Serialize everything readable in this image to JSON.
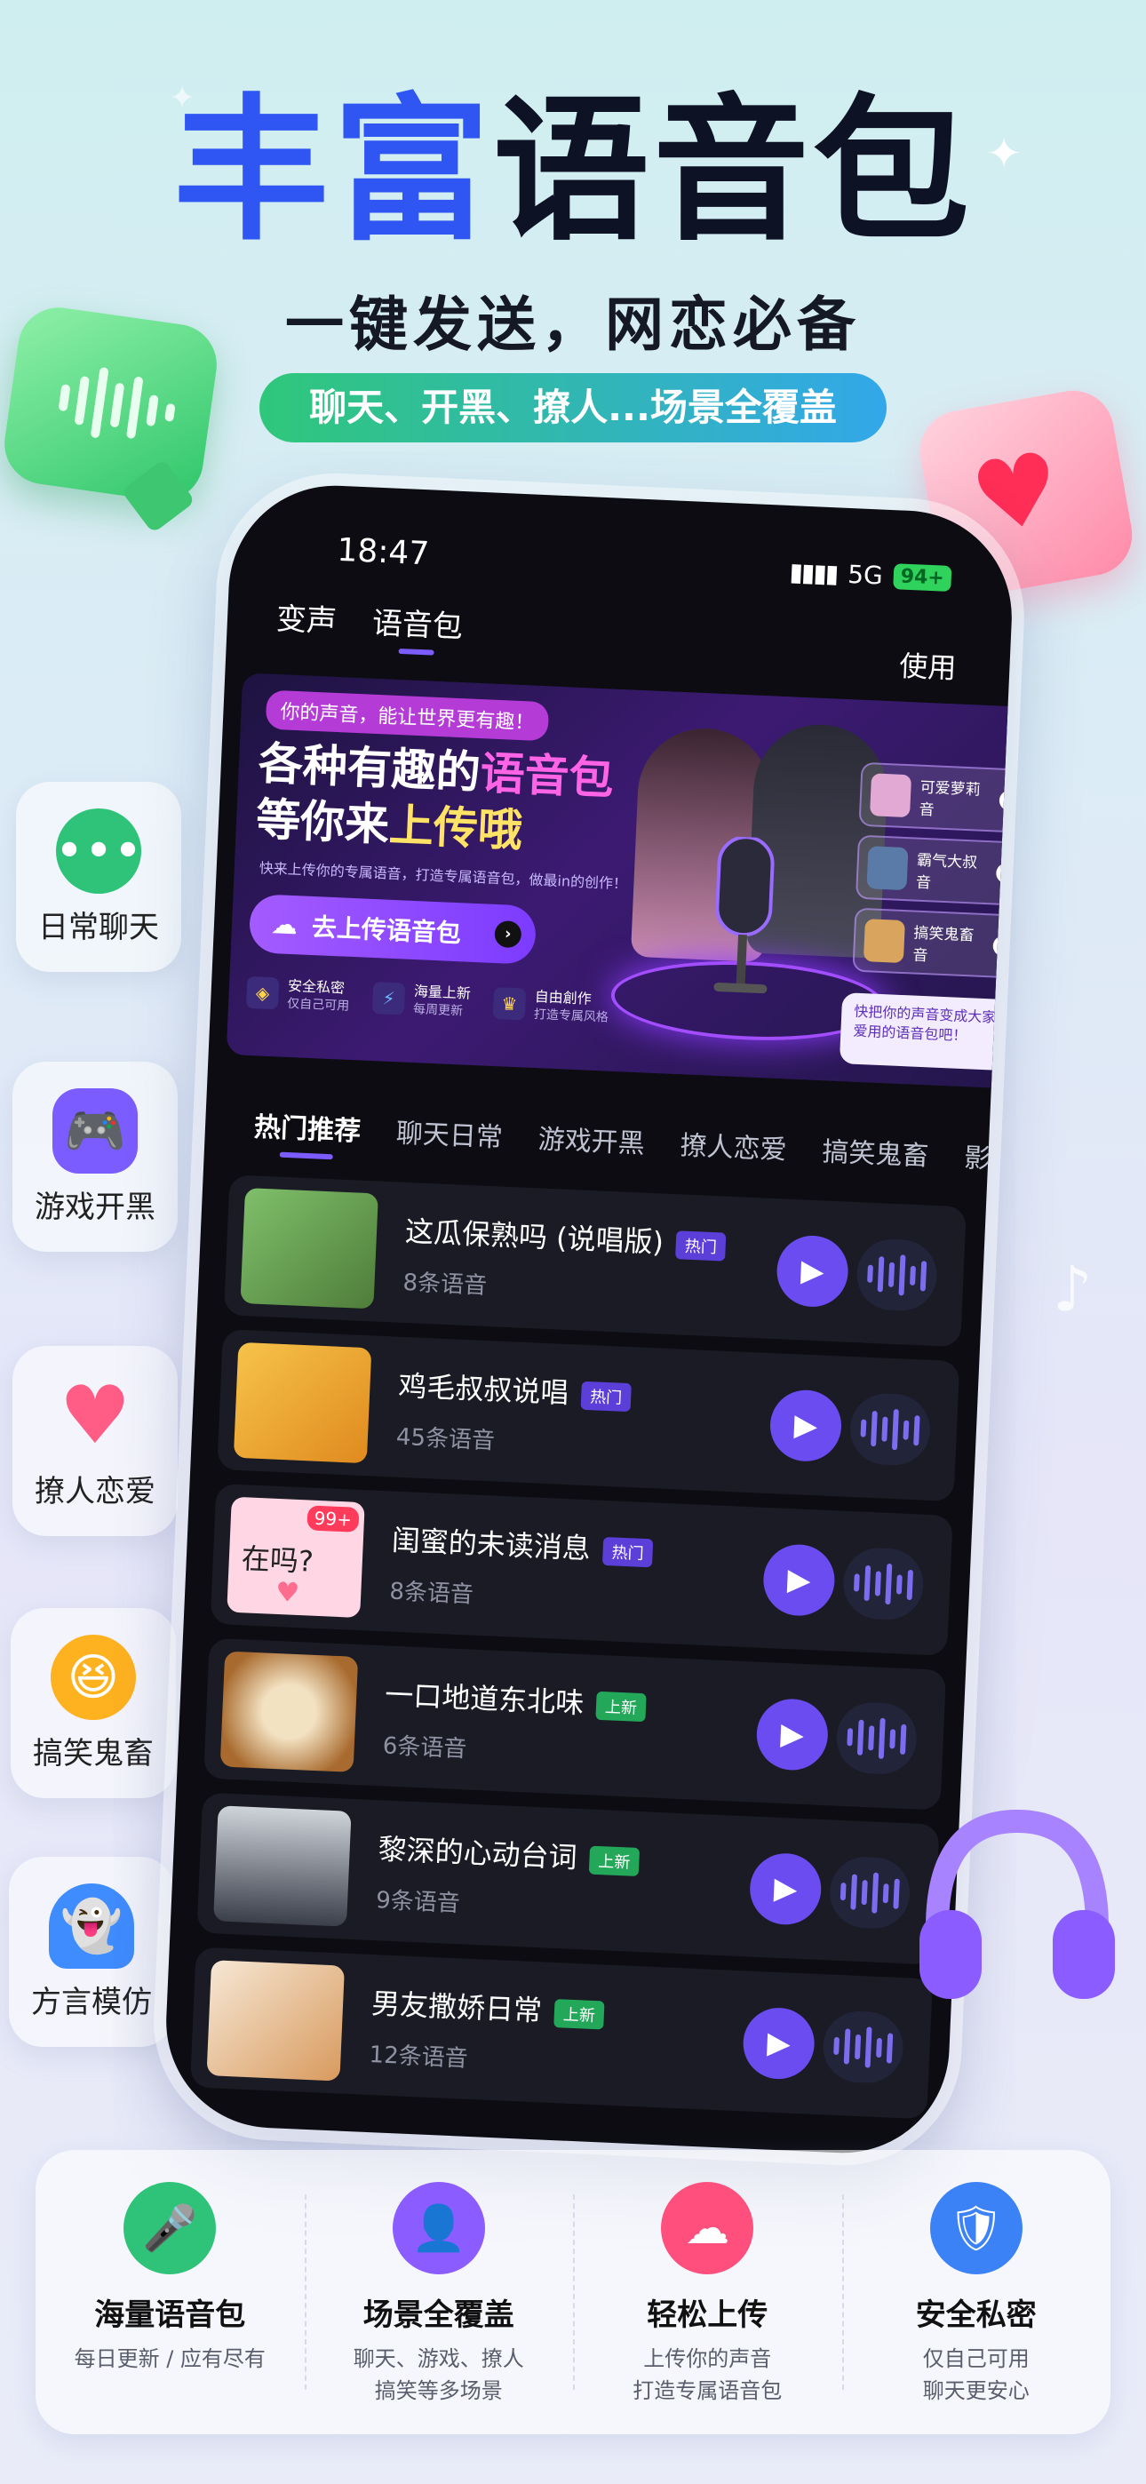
{
  "hero": {
    "title_part1": "丰富",
    "title_part2": "语音包",
    "subtitle": "一键发送，网恋必备",
    "pill": "聊天、开黑、撩人...场景全覆盖"
  },
  "side_categories": [
    {
      "label": "日常聊天",
      "icon": "chat-bubble-icon",
      "color": "#2fc37a"
    },
    {
      "label": "游戏开黑",
      "icon": "gamepad-icon",
      "color": "#7b5cff"
    },
    {
      "label": "撩人恋爱",
      "icon": "heart-icon",
      "color": "#ff5c86"
    },
    {
      "label": "搞笑鬼畜",
      "icon": "laughing-face-icon",
      "color": "#ffb21f"
    },
    {
      "label": "方言模仿",
      "icon": "ghost-icon",
      "color": "#3f8cff"
    }
  ],
  "phone": {
    "time": "18:47",
    "network": "5G",
    "battery": "94+",
    "tabs": [
      {
        "label": "变声"
      },
      {
        "label": "语音包"
      }
    ],
    "use_label": "使用",
    "banner": {
      "tag": "你的声音，能让世界更有趣！",
      "line1_a": "各种有趣的",
      "line1_b": "语音包",
      "line2_a": "等你来",
      "line2_b": "上传哦",
      "desc": "快来上传你的专属语音，打造专属语音包，做最in的创作！",
      "cta": "去上传语音包",
      "features": [
        {
          "title": "安全私密",
          "sub": "仅自己可用"
        },
        {
          "title": "海量上新",
          "sub": "每周更新"
        },
        {
          "title": "自由創作",
          "sub": "打造专属风格"
        }
      ],
      "mini_cards": [
        {
          "label": "可爱萝莉音"
        },
        {
          "label": "霸气大叔音"
        },
        {
          "label": "搞笑鬼畜音"
        }
      ],
      "bubble": "快把你的声音变成大家都爱用的语音包吧！"
    },
    "categories": [
      "热门推荐",
      "聊天日常",
      "游戏开黑",
      "撩人恋爱",
      "搞笑鬼畜",
      "影视动漫"
    ],
    "items": [
      {
        "title": "这瓜保熟吗 (说唱版)",
        "badge": "热门",
        "badge_color": "#5b3fd8",
        "count": "8条语音"
      },
      {
        "title": "鸡毛叔叔说唱",
        "badge": "热门",
        "badge_color": "#5b3fd8",
        "count": "45条语音"
      },
      {
        "title": "闺蜜的未读消息",
        "badge": "热门",
        "badge_color": "#5b3fd8",
        "count": "8条语音",
        "thumb_text": "在吗?",
        "thumb_badge": "99+"
      },
      {
        "title": "一口地道东北味",
        "badge": "上新",
        "badge_color": "#23a85a",
        "count": "6条语音"
      },
      {
        "title": "黎深的心动台词",
        "badge": "上新",
        "badge_color": "#23a85a",
        "count": "9条语音"
      },
      {
        "title": "男友撒娇日常",
        "badge": "上新",
        "badge_color": "#23a85a",
        "count": "12条语音"
      }
    ]
  },
  "features": [
    {
      "title": "海量语音包",
      "desc1": "每日更新 / 应有尽有",
      "desc2": "",
      "icon": "microphone-icon",
      "color": "#2fc37a"
    },
    {
      "title": "场景全覆盖",
      "desc1": "聊天、游戏、撩人",
      "desc2": "搞笑等多场景",
      "icon": "user-scene-icon",
      "color": "#8b5cff"
    },
    {
      "title": "轻松上传",
      "desc1": "上传你的声音",
      "desc2": "打造专属语音包",
      "icon": "cloud-upload-icon",
      "color": "#ff4f7d"
    },
    {
      "title": "安全私密",
      "desc1": "仅自己可用",
      "desc2": "聊天更安心",
      "icon": "shield-icon",
      "color": "#3b82f6"
    }
  ]
}
